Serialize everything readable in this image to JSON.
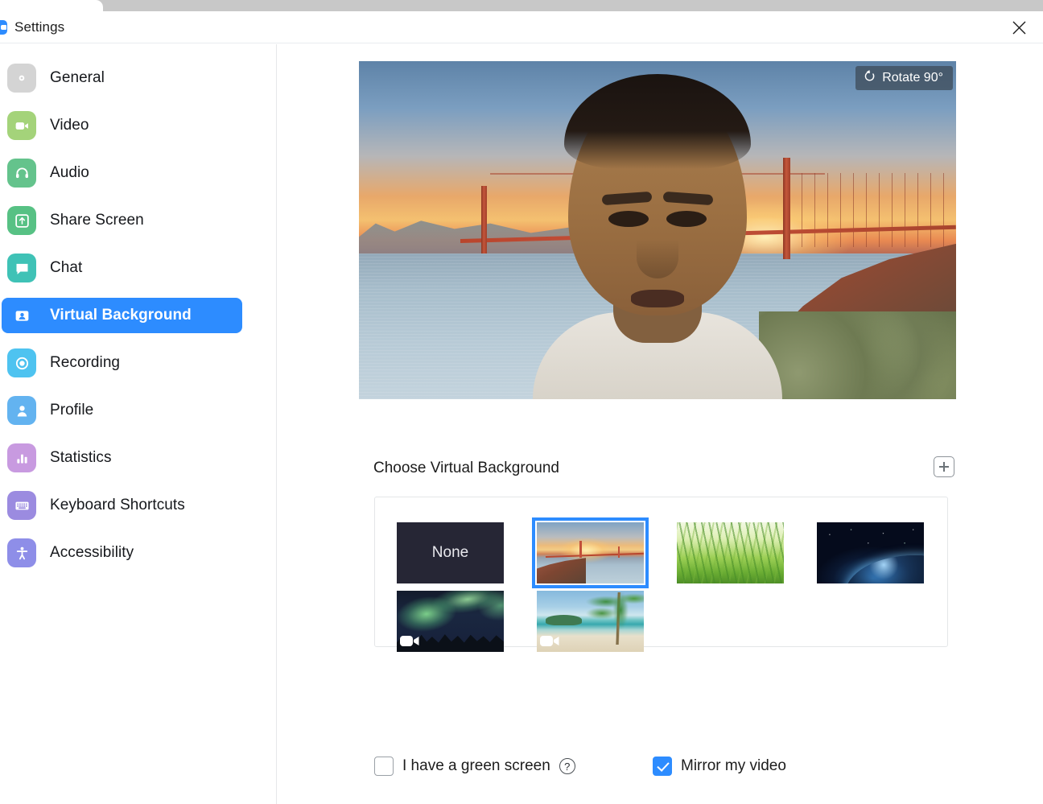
{
  "window": {
    "title": "Settings",
    "logo_icon": "zoom-logo-icon",
    "close_icon": "close-icon"
  },
  "sidebar": {
    "items": [
      {
        "label": "General",
        "icon": "gear-icon",
        "color": "#d4d4d4",
        "active": false
      },
      {
        "label": "Video",
        "icon": "video-camera-icon",
        "color": "#a4d37a",
        "active": false
      },
      {
        "label": "Audio",
        "icon": "headphones-icon",
        "color": "#64c38c",
        "active": false
      },
      {
        "label": "Share Screen",
        "icon": "share-screen-icon",
        "color": "#57c184",
        "active": false
      },
      {
        "label": "Chat",
        "icon": "chat-bubble-icon",
        "color": "#3fc2b6",
        "active": false
      },
      {
        "label": "Virtual Background",
        "icon": "person-card-icon",
        "color": "#2d8cff",
        "active": true
      },
      {
        "label": "Recording",
        "icon": "record-circle-icon",
        "color": "#4ec3f0",
        "active": false
      },
      {
        "label": "Profile",
        "icon": "person-icon",
        "color": "#63b3f0",
        "active": false
      },
      {
        "label": "Statistics",
        "icon": "bar-chart-icon",
        "color": "#c89ae0",
        "active": false
      },
      {
        "label": "Keyboard Shortcuts",
        "icon": "keyboard-icon",
        "color": "#9b8be0",
        "active": false
      },
      {
        "label": "Accessibility",
        "icon": "accessibility-icon",
        "color": "#8e8ee8",
        "active": false
      }
    ],
    "accent_color": "#2d8cff"
  },
  "preview": {
    "rotate_button_label": "Rotate 90°",
    "rotate_icon": "rotate-ccw-icon",
    "description": "Self-view camera preview with Golden Gate Bridge sunset virtual background applied"
  },
  "virtual_background": {
    "section_title": "Choose Virtual Background",
    "add_button_icon": "plus-icon",
    "thumbnails": [
      {
        "name": "None",
        "label": "None",
        "art": "art-none",
        "selected": false,
        "is_video": false
      },
      {
        "name": "Golden Gate Bridge",
        "label": "",
        "art": "art-bridge",
        "selected": true,
        "is_video": false
      },
      {
        "name": "Grass",
        "label": "",
        "art": "art-grass",
        "selected": false,
        "is_video": false
      },
      {
        "name": "Earth from Space",
        "label": "",
        "art": "art-space",
        "selected": false,
        "is_video": false
      },
      {
        "name": "Northern Lights",
        "label": "",
        "art": "art-aurora",
        "selected": false,
        "is_video": true
      },
      {
        "name": "Tropical Beach",
        "label": "",
        "art": "art-beach",
        "selected": false,
        "is_video": true
      }
    ]
  },
  "options": {
    "green_screen": {
      "label": "I have a green screen",
      "checked": false,
      "help_icon": "question-mark-icon",
      "help_glyph": "?"
    },
    "mirror_video": {
      "label": "Mirror my video",
      "checked": true
    }
  },
  "colors": {
    "accent": "#2d8cff",
    "text": "#1c1c1c",
    "divider": "#e6e8ea"
  }
}
